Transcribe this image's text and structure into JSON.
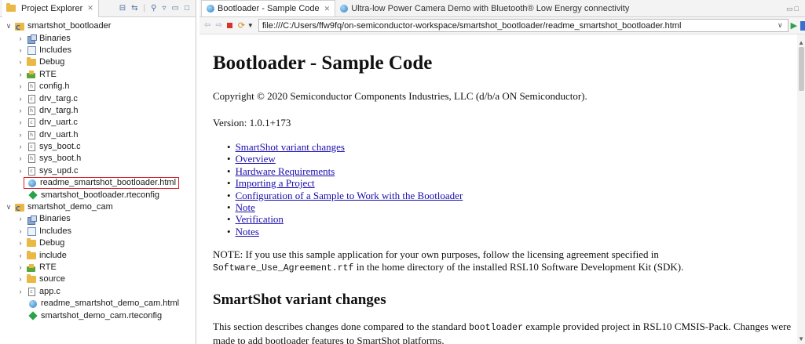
{
  "explorer": {
    "tab_title": "Project Explorer",
    "tab_close": "✕",
    "tree": [
      {
        "label": "smartshot_bootloader",
        "level": 0,
        "icon": "project",
        "toggle": "open"
      },
      {
        "label": "Binaries",
        "level": 1,
        "icon": "binaries",
        "toggle": "closed"
      },
      {
        "label": "Includes",
        "level": 1,
        "icon": "includes",
        "toggle": "closed"
      },
      {
        "label": "Debug",
        "level": 1,
        "icon": "folder",
        "toggle": "closed"
      },
      {
        "label": "RTE",
        "level": 1,
        "icon": "rte",
        "toggle": "closed"
      },
      {
        "label": "config.h",
        "level": 1,
        "icon": "file-h",
        "toggle": "closed"
      },
      {
        "label": "drv_targ.c",
        "level": 1,
        "icon": "file-c",
        "toggle": "closed"
      },
      {
        "label": "drv_targ.h",
        "level": 1,
        "icon": "file-h",
        "toggle": "closed"
      },
      {
        "label": "drv_uart.c",
        "level": 1,
        "icon": "file-c",
        "toggle": "closed"
      },
      {
        "label": "drv_uart.h",
        "level": 1,
        "icon": "file-h",
        "toggle": "closed"
      },
      {
        "label": "sys_boot.c",
        "level": 1,
        "icon": "file-c",
        "toggle": "closed"
      },
      {
        "label": "sys_boot.h",
        "level": 1,
        "icon": "file-h",
        "toggle": "closed"
      },
      {
        "label": "sys_upd.c",
        "level": 1,
        "icon": "file-c",
        "toggle": "closed"
      },
      {
        "label": "readme_smartshot_bootloader.html",
        "level": 2,
        "icon": "globe",
        "toggle": "none",
        "highlighted": true
      },
      {
        "label": "smartshot_bootloader.rteconfig",
        "level": 2,
        "icon": "diamond",
        "toggle": "none"
      },
      {
        "label": "smartshot_demo_cam",
        "level": 0,
        "icon": "project",
        "toggle": "open"
      },
      {
        "label": "Binaries",
        "level": 1,
        "icon": "binaries",
        "toggle": "closed"
      },
      {
        "label": "Includes",
        "level": 1,
        "icon": "includes",
        "toggle": "closed"
      },
      {
        "label": "Debug",
        "level": 1,
        "icon": "folder",
        "toggle": "closed"
      },
      {
        "label": "include",
        "level": 1,
        "icon": "folder",
        "toggle": "closed"
      },
      {
        "label": "RTE",
        "level": 1,
        "icon": "rte",
        "toggle": "closed"
      },
      {
        "label": "source",
        "level": 1,
        "icon": "folder",
        "toggle": "closed"
      },
      {
        "label": "app.c",
        "level": 1,
        "icon": "file-c",
        "toggle": "closed"
      },
      {
        "label": "readme_smartshot_demo_cam.html",
        "level": 2,
        "icon": "globe",
        "toggle": "none"
      },
      {
        "label": "smartshot_demo_cam.rteconfig",
        "level": 2,
        "icon": "diamond",
        "toggle": "none"
      }
    ]
  },
  "browser": {
    "tabs": [
      {
        "label": "Bootloader - Sample Code",
        "close": "✕",
        "active": true
      },
      {
        "label": "Ultra-low Power Camera Demo with Bluetooth® Low Energy connectivity",
        "active": false
      }
    ],
    "url": "file:///C:/Users/ffw9fq/on-semiconductor-workspace/smartshot_bootloader/readme_smartshot_bootloader.html"
  },
  "doc": {
    "title": "Bootloader - Sample Code",
    "copyright": "Copyright © 2020 Semiconductor Components Industries, LLC (d/b/a ON Semiconductor).",
    "version": "Version: 1.0.1+173",
    "toc": [
      "SmartShot variant changes",
      "Overview",
      "Hardware Requirements",
      "Importing a Project",
      "Configuration of a Sample to Work with the Bootloader",
      "Note",
      "Verification",
      "Notes"
    ],
    "note_prefix": "NOTE: If you use this sample application for your own purposes, follow the licensing agreement specified in",
    "note_code": "Software_Use_Agreement.rtf",
    "note_suffix": " in the home directory of the installed RSL10 Software Development Kit (SDK).",
    "section_title": "SmartShot variant changes",
    "section_desc_prefix": "This section describes changes done compared to the standard ",
    "section_desc_code": "bootloader",
    "section_desc_suffix": " example provided project in RSL10 CMSIS-Pack. Changes were made to add bootloader features to SmartShot platforms."
  }
}
